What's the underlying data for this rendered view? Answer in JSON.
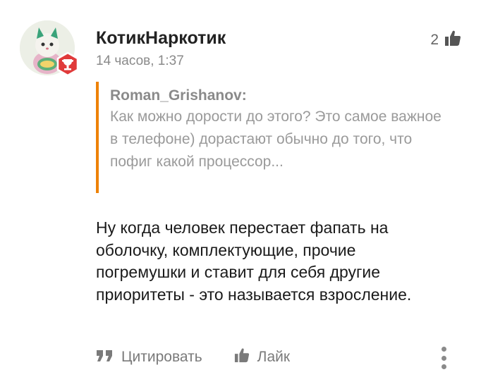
{
  "comment": {
    "author": "КотикНаркотик",
    "time": "14 часов, 1:37",
    "likes_count": "2",
    "quote": {
      "author": "Roman_Grishanov:",
      "text": "Как можно дорости до этого? Это самое важное в телефоне) дорастают обычно до того, что пофиг какой процессор..."
    },
    "text": "Ну когда человек перестает фапать на оболочку, комплектующие, прочие погремушки и ставит для себя другие приоритеты - это называется взросление.",
    "actions": {
      "quote_label": "Цитировать",
      "like_label": "Лайк"
    }
  },
  "colors": {
    "quote_border": "#ee8208",
    "badge": "#e03a3a",
    "muted_text": "#8a8a8a"
  },
  "icons": [
    "trophy-badge-icon",
    "thumbs-up-icon",
    "quote-icon",
    "more-vertical-icon"
  ]
}
